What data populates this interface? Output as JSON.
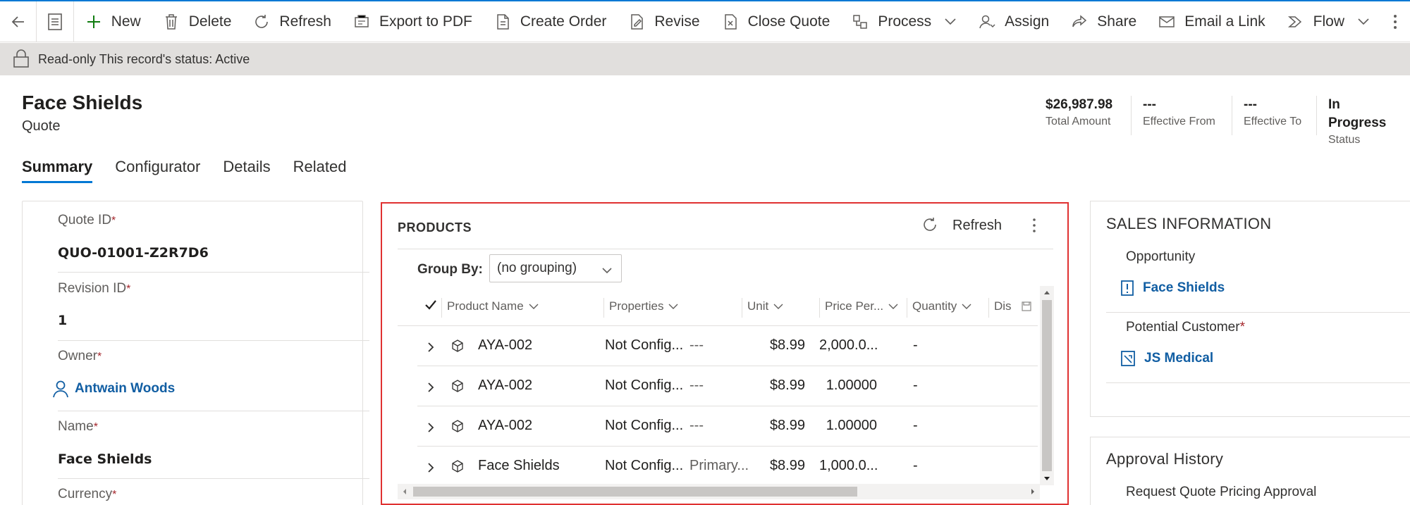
{
  "commandbar": {
    "items": [
      {
        "label": "New",
        "icon": "plus-icon"
      },
      {
        "label": "Delete",
        "icon": "trash-icon"
      },
      {
        "label": "Refresh",
        "icon": "refresh-icon"
      },
      {
        "label": "Export to PDF",
        "icon": "pdf-icon"
      },
      {
        "label": "Create Order",
        "icon": "create-order-icon"
      },
      {
        "label": "Revise",
        "icon": "revise-icon"
      },
      {
        "label": "Close Quote",
        "icon": "close-quote-icon"
      },
      {
        "label": "Process",
        "icon": "process-icon"
      },
      {
        "label": "Assign",
        "icon": "assign-icon"
      },
      {
        "label": "Share",
        "icon": "share-icon"
      },
      {
        "label": "Email a Link",
        "icon": "email-icon"
      },
      {
        "label": "Flow",
        "icon": "flow-icon"
      }
    ]
  },
  "banner": {
    "text": "Read-only This record's status: Active"
  },
  "record": {
    "title": "Face Shields",
    "type": "Quote"
  },
  "header_fields": [
    {
      "value": "$26,987.98",
      "label": "Total Amount"
    },
    {
      "value": "---",
      "label": "Effective From"
    },
    {
      "value": "---",
      "label": "Effective To"
    },
    {
      "value": "In Progress",
      "label": "Status"
    }
  ],
  "tabs": [
    "Summary",
    "Configurator",
    "Details",
    "Related"
  ],
  "summary": {
    "quote_id": {
      "label": "Quote ID",
      "value": "QUO-01001-Z2R7D6"
    },
    "revision_id": {
      "label": "Revision ID",
      "value": "1"
    },
    "owner": {
      "label": "Owner",
      "value": "Antwain Woods"
    },
    "name": {
      "label": "Name",
      "value": "Face Shields"
    },
    "currency": {
      "label": "Currency"
    },
    "required_marker": "*"
  },
  "products": {
    "title": "PRODUCTS",
    "refresh_label": "Refresh",
    "group_by_label": "Group By:",
    "group_by_value": "(no grouping)",
    "columns": [
      "Product Name",
      "Properties",
      "Unit",
      "Price Per...",
      "Quantity",
      "Dis"
    ],
    "rows": [
      {
        "name": "AYA-002",
        "properties": "Not Config...",
        "unit": "---",
        "price": "$8.99",
        "quantity": "2,000.0...",
        "dis": "-"
      },
      {
        "name": "AYA-002",
        "properties": "Not Config...",
        "unit": "---",
        "price": "$8.99",
        "quantity": "1.00000",
        "dis": "-"
      },
      {
        "name": "AYA-002",
        "properties": "Not Config...",
        "unit": "---",
        "price": "$8.99",
        "quantity": "1.00000",
        "dis": "-"
      },
      {
        "name": "Face Shields",
        "properties": "Not Config...",
        "unit": "Primary...",
        "price": "$8.99",
        "quantity": "1,000.0...",
        "dis": "-"
      }
    ]
  },
  "sales_info": {
    "title": "SALES INFORMATION",
    "opportunity": {
      "label": "Opportunity",
      "value": "Face Shields"
    },
    "potential_customer": {
      "label": "Potential Customer",
      "value": "JS Medical"
    }
  },
  "approval_history": {
    "title": "Approval History",
    "item": "Request Quote Pricing Approval"
  }
}
